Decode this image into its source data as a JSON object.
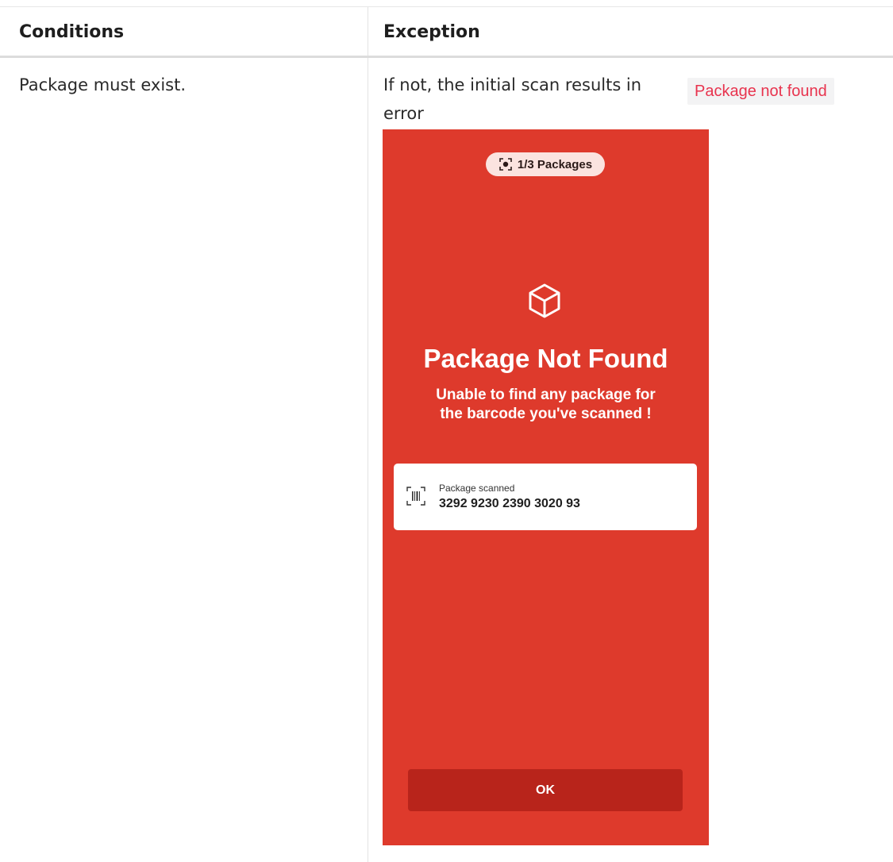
{
  "table": {
    "headers": [
      "Conditions",
      "Exception"
    ],
    "rows": [
      {
        "condition": "Package must exist.",
        "exception_prefix": "If not, the initial scan results in",
        "exception_code": "Package not found",
        "exception_suffix": "error"
      }
    ]
  },
  "phone": {
    "background_color": "#de3a2c",
    "pill_label": "1/3 Packages",
    "title": "Package Not Found",
    "subtitle_line1": "Unable to find any package for",
    "subtitle_line2": "the barcode you've scanned !",
    "card_label": "Package scanned",
    "card_value": "3292 9230 2390 3020 93",
    "ok_label": "OK"
  }
}
